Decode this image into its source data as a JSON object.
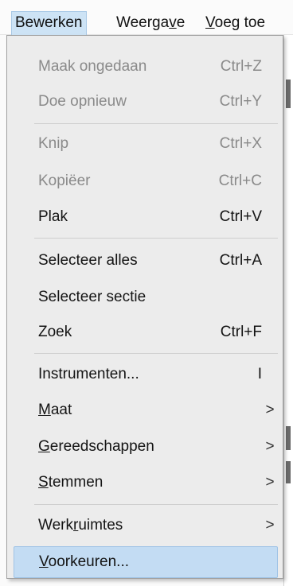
{
  "menubar": {
    "items": [
      {
        "label": "Bewerken"
      },
      {
        "label_pre": "Weerga",
        "label_mn": "v",
        "label_post": "e"
      },
      {
        "label_pre": "",
        "label_mn": "V",
        "label_post": "oeg toe"
      }
    ]
  },
  "menu": {
    "items": [
      {
        "label": "Maak ongedaan",
        "shortcut": "Ctrl+Z",
        "disabled": true
      },
      {
        "label": "Doe opnieuw",
        "shortcut": "Ctrl+Y",
        "disabled": true
      },
      {
        "label": "Knip",
        "shortcut": "Ctrl+X",
        "disabled": true
      },
      {
        "label": "Kopiëer",
        "shortcut": "Ctrl+C",
        "disabled": true
      },
      {
        "label": "Plak",
        "shortcut": "Ctrl+V"
      },
      {
        "label": "Selecteer alles",
        "shortcut": "Ctrl+A"
      },
      {
        "label": "Selecteer sectie",
        "shortcut": ""
      },
      {
        "label": "Zoek",
        "shortcut": "Ctrl+F"
      },
      {
        "label": "Instrumenten...",
        "shortcut": "I"
      },
      {
        "label_pre": "",
        "label_mn": "M",
        "label_post": "aat",
        "submenu_arrow": ">"
      },
      {
        "label_pre": "",
        "label_mn": "G",
        "label_post": "ereedschappen",
        "submenu_arrow": ">"
      },
      {
        "label_pre": "",
        "label_mn": "S",
        "label_post": "temmen",
        "submenu_arrow": ">"
      },
      {
        "label_pre": "Werk",
        "label_mn": "r",
        "label_post": "uimtes",
        "submenu_arrow": ">"
      },
      {
        "label_pre": "",
        "label_mn": "V",
        "label_post": "oorkeuren...",
        "highlighted": true
      }
    ]
  }
}
